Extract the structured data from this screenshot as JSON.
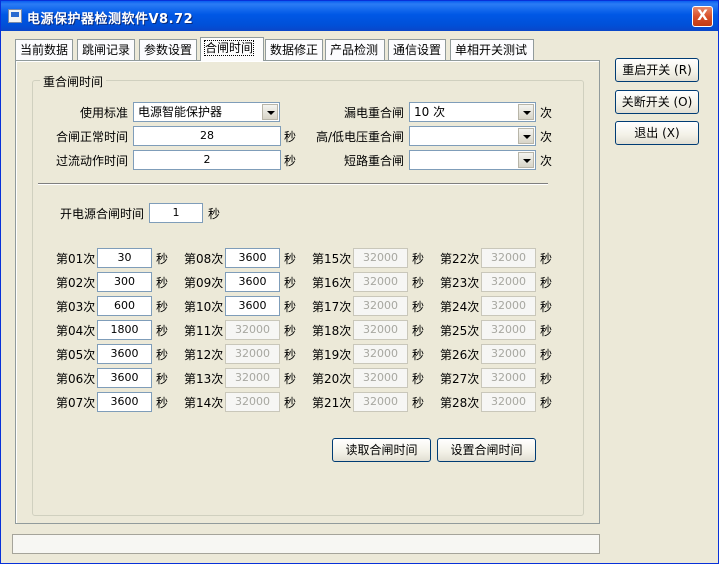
{
  "window": {
    "title": "电源保护器检测软件V8.72",
    "close_label": "X"
  },
  "tabs": [
    "当前数据",
    "跳闸记录",
    "参数设置",
    "合闸时间",
    "数据修正",
    "产品检测",
    "通信设置",
    "单相开关测试"
  ],
  "group_title": "重合闸时间",
  "settings": {
    "standard_label": "使用标准",
    "standard_value": "电源智能保护器",
    "normal_label": "合闸正常时间",
    "normal_value": "28",
    "normal_unit": "秒",
    "overcurrent_label": "过流动作时间",
    "overcurrent_value": "2",
    "overcurrent_unit": "秒",
    "leak_label": "漏电重合闸",
    "leak_value": "10 次",
    "leak_unit": "次",
    "voltage_label": "高/低电压重合闸",
    "voltage_value": "",
    "voltage_unit": "次",
    "short_label": "短路重合闸",
    "short_value": "",
    "short_unit": "次"
  },
  "power_on": {
    "label": "开电源合闸时间",
    "value": "1",
    "unit": "秒"
  },
  "times": {
    "unit": "秒",
    "labels": [
      "第01次",
      "第02次",
      "第03次",
      "第04次",
      "第05次",
      "第06次",
      "第07次",
      "第08次",
      "第09次",
      "第10次",
      "第11次",
      "第12次",
      "第13次",
      "第14次",
      "第15次",
      "第16次",
      "第17次",
      "第18次",
      "第19次",
      "第20次",
      "第21次",
      "第22次",
      "第23次",
      "第24次",
      "第25次",
      "第26次",
      "第27次",
      "第28次"
    ],
    "values": [
      "30",
      "300",
      "600",
      "1800",
      "3600",
      "3600",
      "3600",
      "3600",
      "3600",
      "3600",
      "32000",
      "32000",
      "32000",
      "32000",
      "32000",
      "32000",
      "32000",
      "32000",
      "32000",
      "32000",
      "32000",
      "32000",
      "32000",
      "32000",
      "32000",
      "32000",
      "32000",
      "32000"
    ],
    "enabled_count": 10
  },
  "buttons": {
    "read": "读取合闸时间",
    "set": "设置合闸时间",
    "restart": "重启开关 (R)",
    "disconnect": "关断开关 (O)",
    "exit": "退出 (X)"
  },
  "status_text": ""
}
